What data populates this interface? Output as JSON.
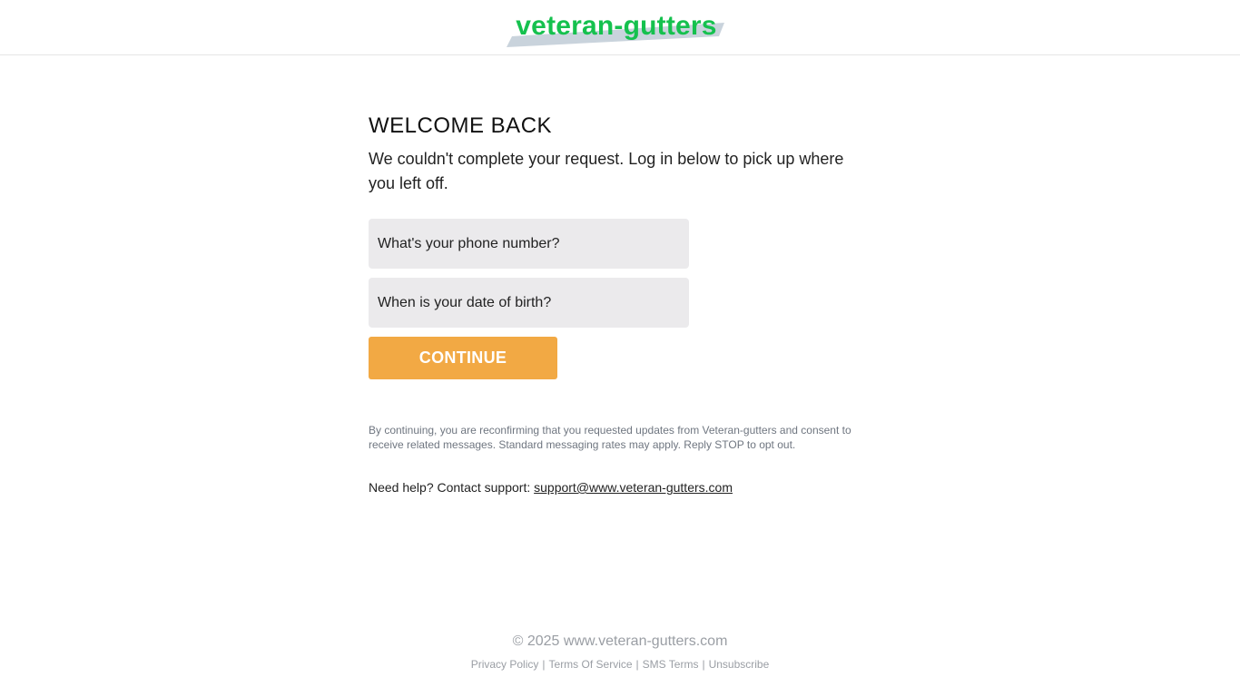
{
  "header": {
    "logo_text": "veteran-gutters"
  },
  "main": {
    "title": "WELCOME BACK",
    "subtitle": "We couldn't complete your request. Log in below to pick up where you left off.",
    "phone_placeholder": "What's your phone number?",
    "dob_placeholder": "When is your date of birth?",
    "continue_label": "CONTINUE",
    "consent_text": "By continuing, you are reconfirming that you requested updates from Veteran-gutters and consent to receive related messages. Standard messaging rates may apply. Reply STOP to opt out.",
    "help_text": "Need help? Contact support:",
    "support_email": "support@www.veteran-gutters.com"
  },
  "footer": {
    "copyright": "© 2025 www.veteran-gutters.com",
    "links": [
      "Privacy Policy",
      "Terms Of Service",
      "SMS Terms",
      "Unsubscribe"
    ],
    "separator": "|"
  },
  "colors": {
    "brand_green": "#15c14e",
    "button_orange": "#f2a944",
    "input_bg": "#ebeaec",
    "logo_swash": "#c9d3dc"
  }
}
